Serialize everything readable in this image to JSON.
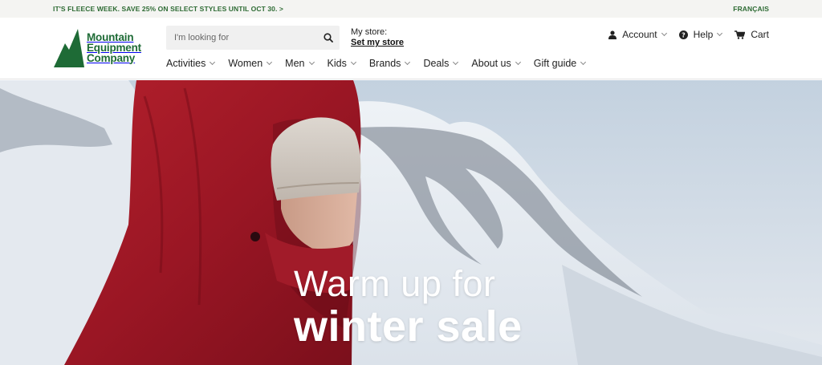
{
  "promo": {
    "message": "IT'S FLEECE WEEK. SAVE 25% ON SELECT STYLES UNTIL OCT 30. >",
    "language": "FRANÇAIS"
  },
  "brand": {
    "line1": "Mountain",
    "line2": "Equipment",
    "line3": "Company",
    "color": "#1e6b36"
  },
  "search": {
    "placeholder": "I'm looking for",
    "icon": "search-icon"
  },
  "store": {
    "label": "My store:",
    "link": "Set my store"
  },
  "utility": {
    "account": "Account",
    "help": "Help",
    "cart": "Cart"
  },
  "nav": [
    {
      "label": "Activities"
    },
    {
      "label": "Women"
    },
    {
      "label": "Men"
    },
    {
      "label": "Kids"
    },
    {
      "label": "Brands"
    },
    {
      "label": "Deals"
    },
    {
      "label": "About us"
    },
    {
      "label": "Gift guide"
    }
  ],
  "hero": {
    "line1": "Warm up for",
    "line2": "winter sale"
  }
}
